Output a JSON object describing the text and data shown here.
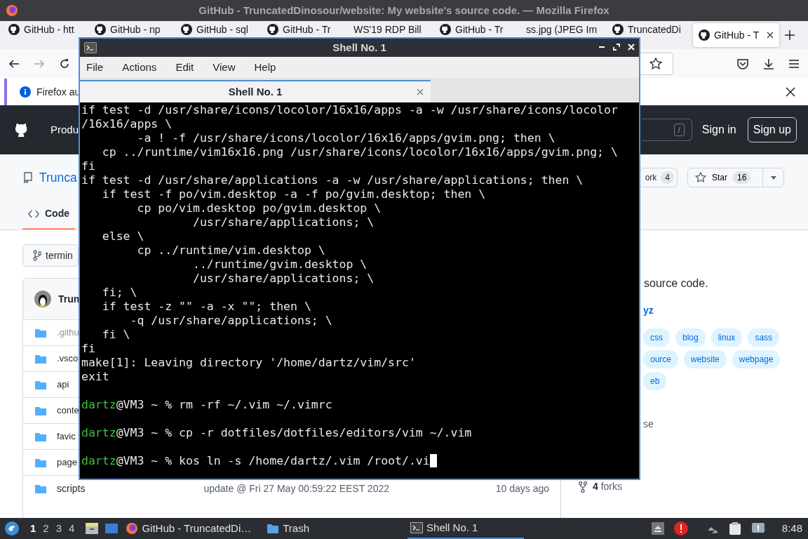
{
  "browser": {
    "title": "GitHub - TruncatedDinosour/website: My website's source code. — Mozilla Firefox",
    "tabs": [
      {
        "label": "GitHub - htt",
        "kind": "site",
        "selected": false
      },
      {
        "label": "GitHub - np",
        "kind": "site",
        "selected": false
      },
      {
        "label": "GitHub - sql",
        "kind": "site",
        "selected": false
      },
      {
        "label": "GitHub - Tr",
        "kind": "site",
        "selected": false
      },
      {
        "label": "WS'19 RDP Bill",
        "kind": "plain",
        "selected": false
      },
      {
        "label": "GitHub - Tr",
        "kind": "site",
        "selected": false
      },
      {
        "label": "ss.jpg (JPEG Im",
        "kind": "plain",
        "selected": false
      },
      {
        "label": "TruncatedDi",
        "kind": "site",
        "selected": false
      },
      {
        "label": "GitHub - T",
        "kind": "site",
        "selected": true
      }
    ],
    "notification": "Firefox au"
  },
  "github": {
    "nav_item": "Produ",
    "search_key": "/",
    "sign_in": "Sign in",
    "sign_up": "Sign up",
    "repo_name": "Trunca",
    "fork_label": "ork",
    "fork_count": "4",
    "star_label": "Star",
    "star_count": "16",
    "tabs": [
      {
        "label": "Code",
        "selected": true
      }
    ],
    "branch": "termin",
    "commit_author": "Trun",
    "files": [
      {
        "name": ".githu",
        "muted": true
      },
      {
        "name": ".vsco",
        "muted": false
      },
      {
        "name": "api",
        "muted": false
      },
      {
        "name": "conte",
        "muted": false
      },
      {
        "name": "favic",
        "muted": false
      },
      {
        "name": "page",
        "muted": false
      },
      {
        "name": "scripts",
        "muted": false,
        "message": "update @ Fri 27 May 00:59:22 EEST 2022",
        "age": "10 days ago"
      }
    ],
    "about": {
      "description": "source code.",
      "link": "yz",
      "topic_rows": [
        [
          "css",
          "blog",
          "linux",
          "sass"
        ],
        [
          "ource",
          "website",
          "webpage"
        ],
        [
          "eb"
        ]
      ],
      "license": "se",
      "forks_count": "4",
      "forks_label": "forks"
    }
  },
  "terminal": {
    "title": "Shell No. 1",
    "menu": [
      "File",
      "Actions",
      "Edit",
      "View",
      "Help"
    ],
    "tab": "Shell No. 1",
    "lines": [
      {
        "kind": "output",
        "text": "if test -d /usr/share/icons/locolor/16x16/apps -a -w /usr/share/icons/locolor"
      },
      {
        "kind": "output",
        "text": "/16x16/apps \\"
      },
      {
        "kind": "output",
        "text": "        -a ! -f /usr/share/icons/locolor/16x16/apps/gvim.png; then \\"
      },
      {
        "kind": "output",
        "text": "   cp ../runtime/vim16x16.png /usr/share/icons/locolor/16x16/apps/gvim.png; \\"
      },
      {
        "kind": "output",
        "text": "fi"
      },
      {
        "kind": "output",
        "text": "if test -d /usr/share/applications -a -w /usr/share/applications; then \\"
      },
      {
        "kind": "output",
        "text": "   if test -f po/vim.desktop -a -f po/gvim.desktop; then \\"
      },
      {
        "kind": "output",
        "text": "        cp po/vim.desktop po/gvim.desktop \\"
      },
      {
        "kind": "output",
        "text": "                /usr/share/applications; \\"
      },
      {
        "kind": "output",
        "text": "   else \\"
      },
      {
        "kind": "output",
        "text": "        cp ../runtime/vim.desktop \\"
      },
      {
        "kind": "output",
        "text": "                ../runtime/gvim.desktop \\"
      },
      {
        "kind": "output",
        "text": "                /usr/share/applications; \\"
      },
      {
        "kind": "output",
        "text": "   fi; \\"
      },
      {
        "kind": "output",
        "text": "   if test -z \"\" -a -x \"\"; then \\"
      },
      {
        "kind": "output",
        "text": "       -q /usr/share/applications; \\"
      },
      {
        "kind": "output",
        "text": "   fi \\"
      },
      {
        "kind": "output",
        "text": "fi"
      },
      {
        "kind": "output",
        "text": "make[1]: Leaving directory '/home/dartz/vim/src'"
      },
      {
        "kind": "output",
        "text": "exit"
      },
      {
        "kind": "blank"
      },
      {
        "kind": "prompt",
        "user": "dartz",
        "prompt": "@VM3 ~ % ",
        "command": "rm -rf ~/.vim ~/.vimrc",
        "cursor": false
      },
      {
        "kind": "blank"
      },
      {
        "kind": "prompt",
        "user": "dartz",
        "prompt": "@VM3 ~ % ",
        "command": "cp -r dotfiles/dotfiles/editors/vim ~/.vim",
        "cursor": false
      },
      {
        "kind": "blank"
      },
      {
        "kind": "prompt",
        "user": "dartz",
        "prompt": "@VM3 ~ % ",
        "command": "kos ln -s /home/dartz/.vim /root/.vi",
        "cursor": true
      }
    ]
  },
  "taskbar": {
    "workspaces": [
      {
        "label": "1",
        "selected": true
      },
      {
        "label": "2",
        "selected": false
      },
      {
        "label": "3",
        "selected": false
      },
      {
        "label": "4",
        "selected": false
      }
    ],
    "tasks": [
      {
        "label": "GitHub - TruncatedDi…",
        "kind": "browser",
        "active": false
      },
      {
        "label": "Trash",
        "kind": "folder",
        "active": false
      },
      {
        "label": "Shell No. 1",
        "kind": "terminal",
        "active": true
      }
    ],
    "clock": "8:48"
  }
}
